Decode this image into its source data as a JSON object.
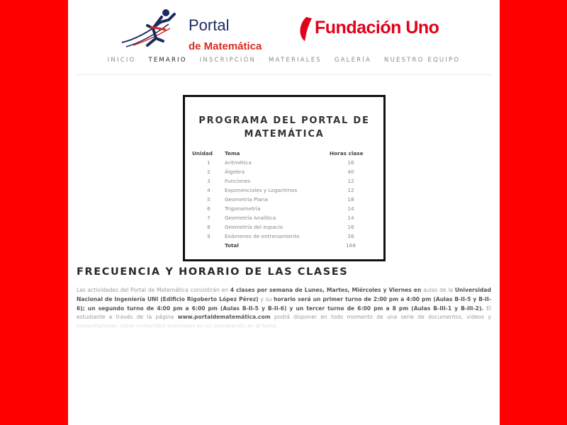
{
  "header": {
    "portal_line1": "Portal",
    "portal_line2": "de Matemática",
    "fundacion": "Fundación Uno"
  },
  "nav": [
    {
      "label": "INICIO",
      "active": false
    },
    {
      "label": "TEMARIO",
      "active": true
    },
    {
      "label": "INSCRIPCIÓN",
      "active": false
    },
    {
      "label": "MATERIALES",
      "active": false
    },
    {
      "label": "GALERÍA",
      "active": false
    },
    {
      "label": "NUESTRO EQUIPO",
      "active": false
    }
  ],
  "program": {
    "title_line1": "PROGRAMA DEL PORTAL DE",
    "title_line2": "MATEMÁTICA",
    "headers": [
      "Unidad",
      "Tema",
      "Horas clase"
    ],
    "rows": [
      [
        "1",
        "Aritmética",
        "16"
      ],
      [
        "2",
        "Álgebra",
        "40"
      ],
      [
        "3",
        "Funciones",
        "12"
      ],
      [
        "4",
        "Exponenciales y Logaritmos",
        "12"
      ],
      [
        "5",
        "Geometría Plana",
        "18"
      ],
      [
        "6",
        "Trigonometría",
        "14"
      ],
      [
        "7",
        "Geometría Analítica",
        "14"
      ],
      [
        "8",
        "Geometría del espacio",
        "16"
      ],
      [
        "9",
        "Exámenes de entrenamiento",
        "26"
      ]
    ],
    "total_label": "Total",
    "total_value": "168"
  },
  "frequency": {
    "title": "FRECUENCIA Y HORARIO DE LAS CLASES",
    "p1": "Las actividades del Portal de Matemática consistirán en ",
    "b1": "4 clases por semana de Lunes, Martes, Miércoles y Viernes en",
    "p2": " aulas de la ",
    "b2": "Universidad Nacional de Ingeniería UNI (Edificio Rigoberto López Pérez)",
    "p3": " y su ",
    "b3": "horario será un primer turno de 2:00 pm a 4:00 pm (Aulas B-II-5 y B-II-6); un segundo turno  de 4:00 pm a 6:00 pm (Aulas B-II-5 y B-II-6) y un tercer turno de 6:00 pm a 8 pm (Aulas B-III-1 y B-III-2).",
    "p4": " El estudiante a través de la página ",
    "b4": "www.portaldematemática.com",
    "p5": " podrá disponer en todo momento de una serie de documentos, videos y presentaciones sobre contenidos esenciales en su preparación en el tema."
  },
  "colors": {
    "side_red": "#ff0000",
    "brand_red": "#e3001b",
    "portal_blue": "#1c2a5e"
  }
}
